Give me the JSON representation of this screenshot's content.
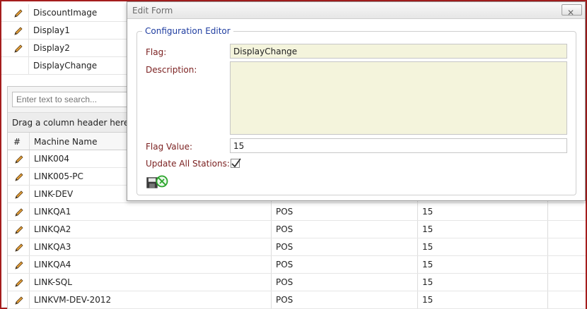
{
  "flags": [
    {
      "name": "DiscountImage",
      "editable": true
    },
    {
      "name": "Display1",
      "editable": true
    },
    {
      "name": "Display2",
      "editable": true
    },
    {
      "name": "DisplayChange",
      "editable": false
    }
  ],
  "grid": {
    "search_placeholder": "Enter text to search...",
    "group_hint": "Drag a column header here",
    "columns": [
      "#",
      "Machine Name"
    ],
    "rows": [
      {
        "machine": "LINK004",
        "type": "",
        "value": ""
      },
      {
        "machine": "LINK005-PC",
        "type": "",
        "value": ""
      },
      {
        "machine": "LINK-DEV",
        "type": "",
        "value": ""
      },
      {
        "machine": "LINKQA1",
        "type": "POS",
        "value": "15"
      },
      {
        "machine": "LINKQA2",
        "type": "POS",
        "value": "15"
      },
      {
        "machine": "LINKQA3",
        "type": "POS",
        "value": "15"
      },
      {
        "machine": "LINKQA4",
        "type": "POS",
        "value": "15"
      },
      {
        "machine": "LINK-SQL",
        "type": "POS",
        "value": "15"
      },
      {
        "machine": "LINKVM-DEV-2012",
        "type": "POS",
        "value": "15"
      }
    ]
  },
  "modal": {
    "title": "Edit Form",
    "legend": "Configuration Editor",
    "flag_label": "Flag:",
    "flag_value": "DisplayChange",
    "description_label": "Description:",
    "description_value": "",
    "flag_value_label": "Flag Value:",
    "flag_value_value": "15",
    "update_all_label": "Update All Stations:",
    "update_all_checked": true
  },
  "colors": {
    "frame_border": "#a51d1d",
    "label_text": "#7a1f1f",
    "legend_text": "#1f3da0",
    "readonly_bg": "#f4f4dc"
  }
}
